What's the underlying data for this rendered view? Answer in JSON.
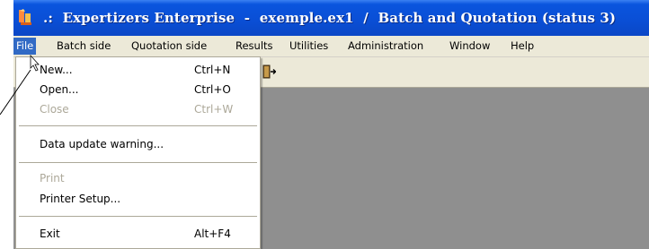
{
  "window": {
    "title": ".:  Expertizers Enterprise  -  exemple.ex1  /  Batch and Quotation (status 3)"
  },
  "menubar": {
    "items": [
      {
        "label": "File"
      },
      {
        "label": "Batch side"
      },
      {
        "label": "Quotation side"
      },
      {
        "label": "Results"
      },
      {
        "label": "Utilities"
      },
      {
        "label": "Administration"
      },
      {
        "label": "Window"
      },
      {
        "label": "Help"
      }
    ]
  },
  "file_menu": {
    "items": [
      {
        "label": "New...",
        "shortcut": "Ctrl+N",
        "enabled": true
      },
      {
        "label": "Open...",
        "shortcut": "Ctrl+O",
        "enabled": true
      },
      {
        "label": "Close",
        "shortcut": "Ctrl+W",
        "enabled": false
      },
      {
        "label": "Data update warning...",
        "shortcut": "",
        "enabled": true
      },
      {
        "label": "Print",
        "shortcut": "",
        "enabled": false
      },
      {
        "label": "Printer Setup...",
        "shortcut": "",
        "enabled": true
      },
      {
        "label": "Exit",
        "shortcut": "Alt+F4",
        "enabled": true
      }
    ]
  },
  "icons": {
    "app": "app-icon",
    "toolbar": "exit-door-icon",
    "cursor": "mouse-pointer-icon"
  },
  "colors": {
    "title_bar": "#0a4fd6",
    "menu_highlight": "#316ac5",
    "menu_bg": "#ece9d8",
    "workspace": "#8f8f8f",
    "disabled_text": "#aca899"
  }
}
